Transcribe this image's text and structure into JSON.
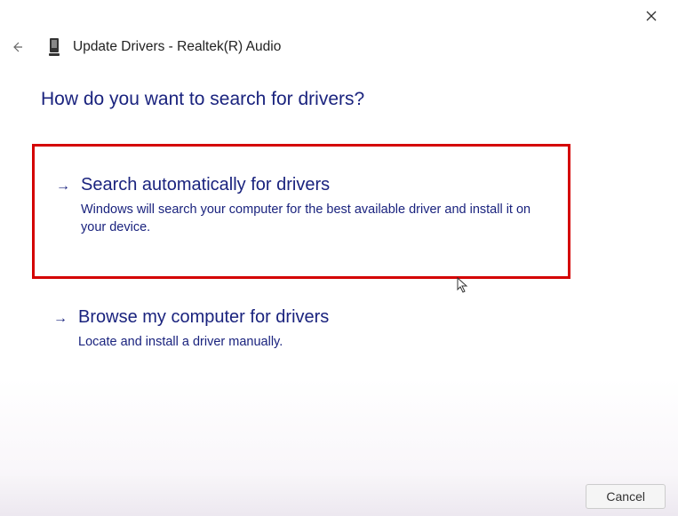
{
  "window": {
    "title": "Update Drivers - Realtek(R) Audio"
  },
  "heading": "How do you want to search for drivers?",
  "options": [
    {
      "title": "Search automatically for drivers",
      "description": "Windows will search your computer for the best available driver and install it on your device.",
      "highlighted": true
    },
    {
      "title": "Browse my computer for drivers",
      "description": "Locate and install a driver manually.",
      "highlighted": false
    }
  ],
  "footer": {
    "cancel_label": "Cancel"
  },
  "colors": {
    "heading": "#1a237e",
    "highlight_border": "#d40000"
  }
}
